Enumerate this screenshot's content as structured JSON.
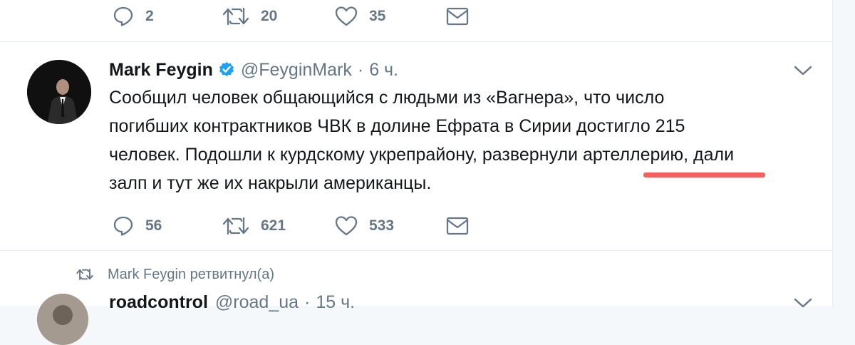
{
  "prev_tweet": {
    "actions": {
      "replies": "2",
      "retweets": "20",
      "likes": "35"
    }
  },
  "tweet": {
    "author_name": "Mark Feygin",
    "handle": "@FeyginMark",
    "separator": "·",
    "time": "6 ч.",
    "text_lines": [
      "Сообщил человек общающийся с людьми из «Вагнера», что число",
      "погибших контрактников ЧВК в долине Ефрата в Сирии достигло 215",
      "человек. Подошли к курдскому укрепрайону, развернули артеллерию, дали",
      "залп и тут же их накрыли американцы."
    ],
    "actions": {
      "replies": "56",
      "retweets": "621",
      "likes": "533"
    },
    "highlight_color": "#f2625a"
  },
  "retweet_notice": {
    "text": "Mark Feygin ретвитнул(а)"
  },
  "next_tweet": {
    "author_name": "roadcontrol",
    "handle": "@road_ua",
    "separator": "·",
    "time": "15 ч."
  },
  "icons": {
    "reply": "reply-icon",
    "retweet": "retweet-icon",
    "like": "heart-icon",
    "message": "envelope-icon",
    "verified": "verified-badge-icon",
    "menu": "chevron-down-icon"
  },
  "colors": {
    "text": "#14171a",
    "secondary": "#657786",
    "verified": "#1da1f2",
    "divider": "#e6ecf0",
    "underline": "#f2625a"
  }
}
